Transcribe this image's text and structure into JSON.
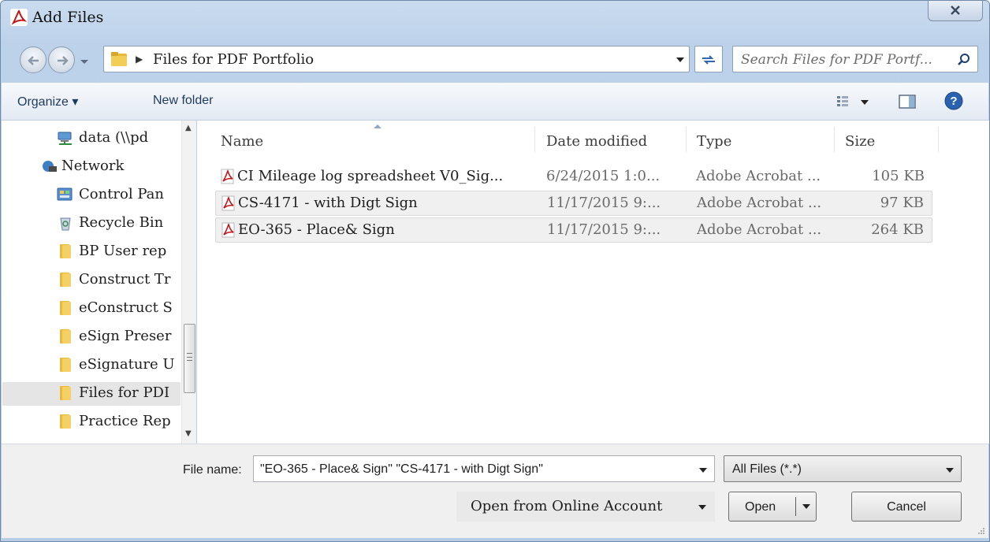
{
  "window": {
    "title": "Add Files"
  },
  "address": {
    "path": "Files for PDF Portfolio",
    "search_placeholder": "Search Files for PDF Portf..."
  },
  "toolbar": {
    "organize": "Organize ▾",
    "new_folder": "New folder"
  },
  "nav": {
    "items": [
      {
        "label": "data (\\\\pd",
        "icon": "network-drive-icon"
      },
      {
        "label": "Network",
        "icon": "network-icon"
      },
      {
        "label": "Control Pan",
        "icon": "control-panel-icon"
      },
      {
        "label": "Recycle Bin",
        "icon": "recycle-bin-icon"
      },
      {
        "label": "BP User rep",
        "icon": "folder-icon"
      },
      {
        "label": "Construct Tr",
        "icon": "folder-icon"
      },
      {
        "label": "eConstruct S",
        "icon": "folder-icon"
      },
      {
        "label": "eSign Preser",
        "icon": "folder-icon"
      },
      {
        "label": "eSignature U",
        "icon": "folder-icon"
      },
      {
        "label": "Files for PDI",
        "icon": "folder-icon",
        "selected": true
      },
      {
        "label": "Practice Rep",
        "icon": "folder-icon"
      }
    ]
  },
  "columns": {
    "name": "Name",
    "date": "Date modified",
    "type": "Type",
    "size": "Size"
  },
  "files": [
    {
      "name": "CI  Mileage log spreadsheet V0_Sig...",
      "date": "6/24/2015 1:0...",
      "type": "Adobe Acrobat ...",
      "size": "105 KB",
      "selected": false
    },
    {
      "name": "CS-4171 - with Digt Sign",
      "date": "11/17/2015 9:...",
      "type": "Adobe Acrobat ...",
      "size": "97 KB",
      "selected": true
    },
    {
      "name": "EO-365 - Place& Sign",
      "date": "11/17/2015 9:...",
      "type": "Adobe Acrobat ...",
      "size": "264 KB",
      "selected": true
    }
  ],
  "footer": {
    "file_name_label": "File name:",
    "file_name_value": "\"EO-365 - Place& Sign\" \"CS-4171 - with Digt Sign\"",
    "file_type": "All Files (*.*)",
    "online_label": "Open from Online Account",
    "open_label": "Open",
    "cancel_label": "Cancel"
  },
  "colors": {
    "frame": "#bcd1ea",
    "selection": "#f0f0f0",
    "pdf_red": "#c4161c",
    "folder_yellow": "#e8b93a"
  }
}
